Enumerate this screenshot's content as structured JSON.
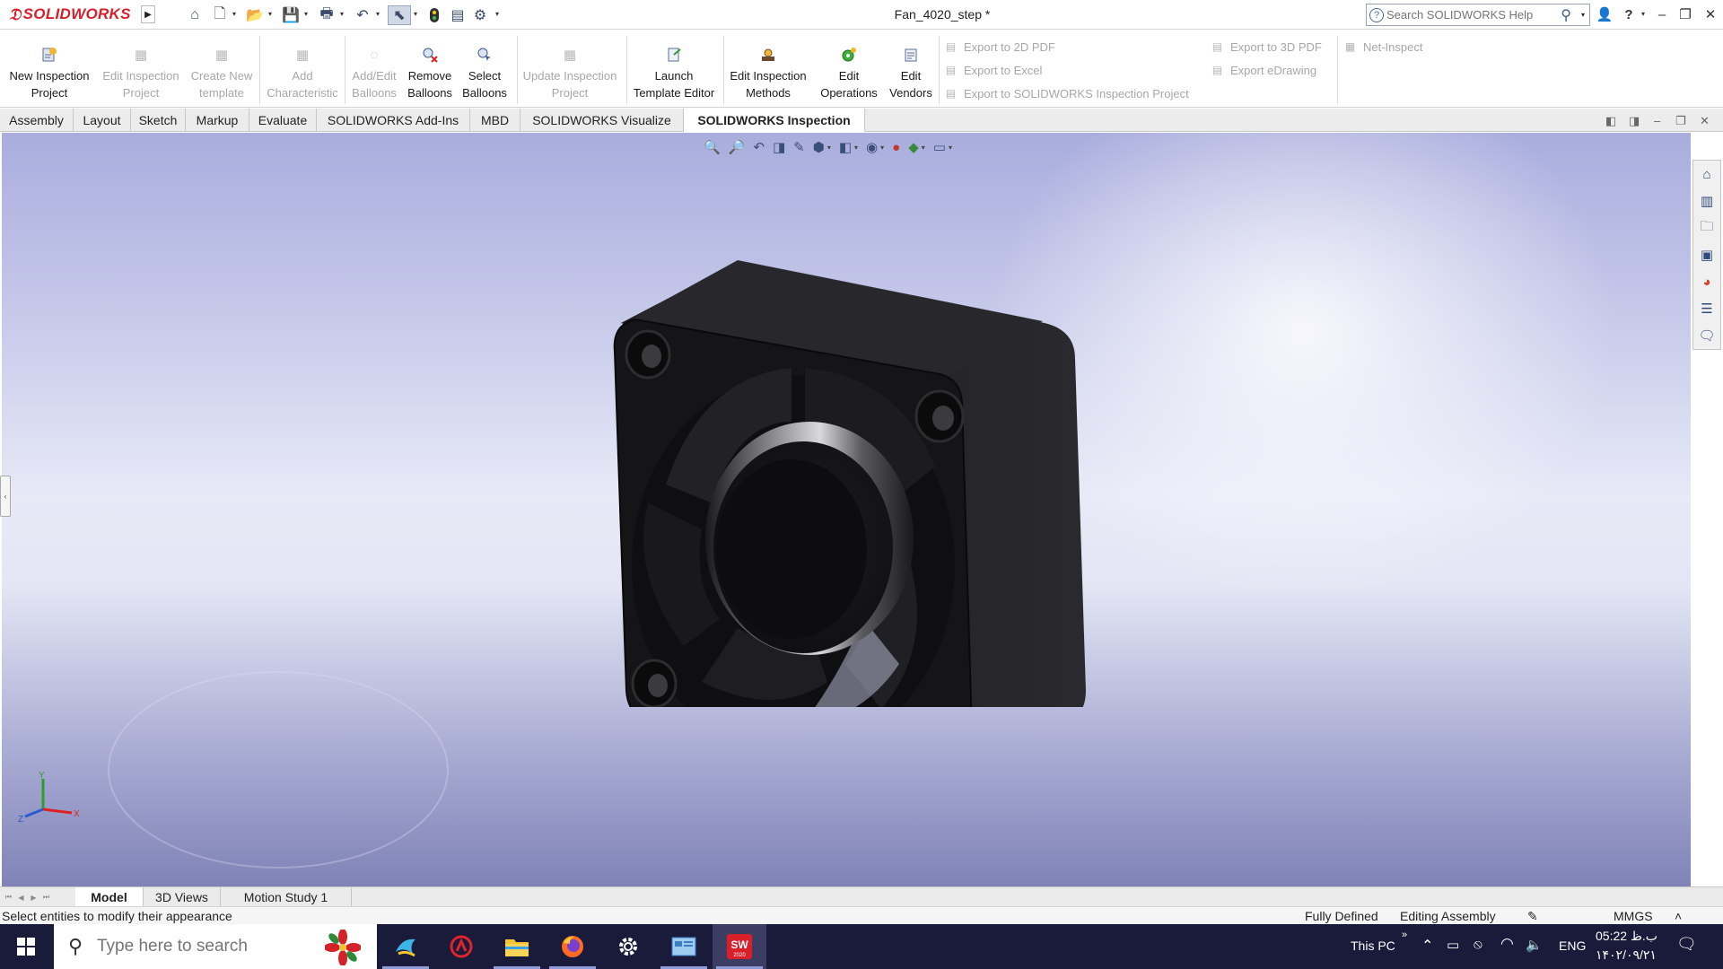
{
  "titlebar": {
    "brand": "SOLIDWORKS",
    "document_title": "Fan_4020_step *",
    "search_placeholder": "Search SOLIDWORKS Help"
  },
  "quick_access_icons": [
    "home-icon",
    "new-document-icon",
    "open-icon",
    "save-icon",
    "print-icon",
    "undo-icon",
    "select-icon",
    "rebuild-icon",
    "file-properties-icon",
    "options-icon"
  ],
  "command_manager": {
    "buttons": [
      {
        "label": "New Inspection\nProject",
        "enabled": true
      },
      {
        "label": "Edit Inspection\nProject",
        "enabled": false
      },
      {
        "label": "Create New\ntemplate",
        "enabled": false
      },
      {
        "label": "Add\nCharacteristic",
        "enabled": false
      },
      {
        "label": "Add/Edit\nBalloons",
        "enabled": false
      },
      {
        "label": "Remove\nBalloons",
        "enabled": true
      },
      {
        "label": "Select\nBalloons",
        "enabled": true
      },
      {
        "label": "Update Inspection\nProject",
        "enabled": false
      },
      {
        "label": "Launch\nTemplate Editor",
        "enabled": true
      },
      {
        "label": "Edit Inspection\nMethods",
        "enabled": true
      },
      {
        "label": "Edit\nOperations",
        "enabled": true
      },
      {
        "label": "Edit\nVendors",
        "enabled": true
      }
    ],
    "exports": {
      "pdf2d": "Export to 2D PDF",
      "excel": "Export to Excel",
      "inspection_project": "Export to SOLIDWORKS Inspection Project",
      "pdf3d": "Export to 3D PDF",
      "edrawing": "Export eDrawing",
      "net_inspect": "Net-Inspect"
    }
  },
  "tabs": [
    "Assembly",
    "Layout",
    "Sketch",
    "Markup",
    "Evaluate",
    "SOLIDWORKS Add-Ins",
    "MBD",
    "SOLIDWORKS Visualize",
    "SOLIDWORKS Inspection"
  ],
  "active_tab": "SOLIDWORKS Inspection",
  "view_toolbar_icons": [
    "zoom-to-fit-icon",
    "zoom-to-area-icon",
    "previous-view-icon",
    "section-view-icon",
    "dynamic-annotation-icon",
    "view-orientation-icon",
    "display-style-icon",
    "hide-show-icon",
    "edit-appearance-icon",
    "apply-scene-icon",
    "view-settings-icon"
  ],
  "task_pane_icons": [
    "resources-icon",
    "design-library-icon",
    "file-explorer-icon",
    "view-palette-icon",
    "appearances-icon",
    "custom-properties-icon",
    "forum-icon"
  ],
  "triad": {
    "x": "X",
    "y": "Y",
    "z": "Z"
  },
  "bottom_tabs": [
    "Model",
    "3D Views",
    "Motion Study 1"
  ],
  "active_bottom_tab": "Model",
  "status": {
    "message": "Select entities to modify their appearance",
    "defined": "Fully Defined",
    "mode": "Editing Assembly",
    "units": "MMGS",
    "units_arrow": "˄"
  },
  "taskbar": {
    "search_placeholder": "Type here to search",
    "apps": [
      "app-icon",
      "autodesk-icon",
      "file-explorer-icon",
      "firefox-icon",
      "settings-icon",
      "control-panel-icon",
      "solidworks-icon"
    ],
    "this_pc": "This PC",
    "language": "ENG",
    "time": "05:22 ب.ظ",
    "date": "۱۴۰۲/۰۹/۲۱",
    "sw_badge": "SW",
    "sw_year": "2020"
  },
  "colors": {
    "brand_red": "#d81f2a",
    "taskbar": "#1a1b3a",
    "viewport_top": "#a9addd",
    "viewport_bottom": "#7f83b7",
    "fan_body": "#151517"
  }
}
